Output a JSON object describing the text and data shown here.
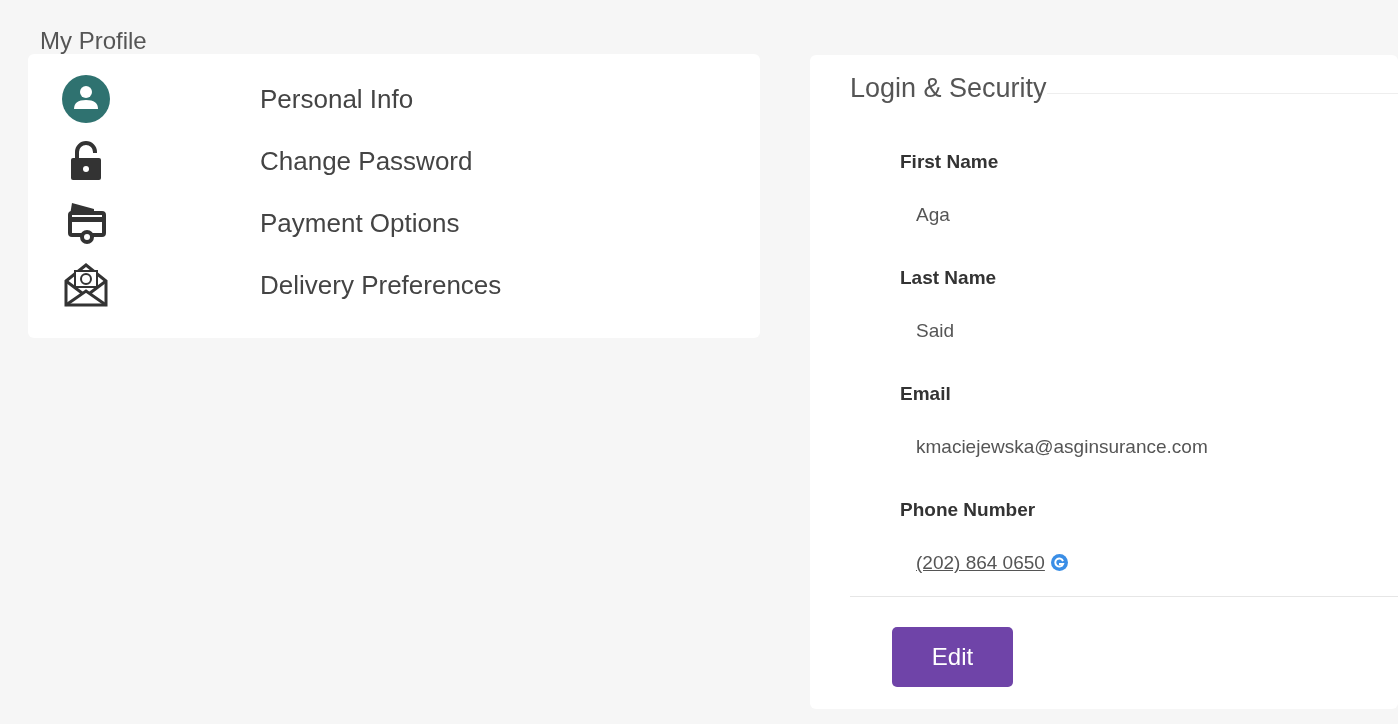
{
  "page_title": "My Profile",
  "menu": [
    {
      "label": "Personal Info"
    },
    {
      "label": "Change Password"
    },
    {
      "label": "Payment Options"
    },
    {
      "label": "Delivery Preferences"
    }
  ],
  "panel": {
    "title": "Login & Security",
    "fields": [
      {
        "label": "First Name",
        "value": "Aga",
        "kind": "text"
      },
      {
        "label": "Last Name",
        "value": "Said",
        "kind": "text"
      },
      {
        "label": "Email",
        "value": "kmaciejewska@asginsurance.com",
        "kind": "text"
      },
      {
        "label": "Phone Number",
        "value": "(202) 864 0650",
        "kind": "phone"
      }
    ],
    "button": "Edit"
  }
}
